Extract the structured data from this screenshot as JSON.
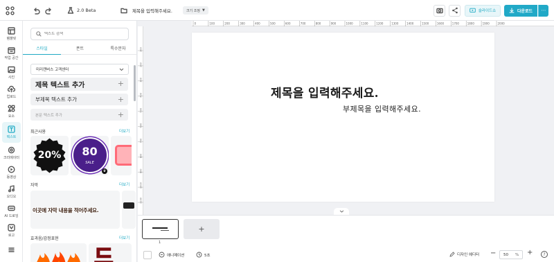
{
  "topbar": {
    "version": "2.0 Beta",
    "doc_title": "제목을 입력해주세요.",
    "size_label": "크기 조정",
    "slideshow_label": "슬라이드쇼",
    "download_label": "다운로드"
  },
  "sidebar": {
    "items": [
      {
        "label": "템플릿",
        "icon": "template-icon"
      },
      {
        "label": "작업 공간",
        "icon": "workspace-icon"
      },
      {
        "label": "사진",
        "icon": "photo-icon"
      },
      {
        "label": "업로드",
        "icon": "upload-icon"
      },
      {
        "label": "요소",
        "icon": "elements-icon"
      },
      {
        "label": "텍스트",
        "icon": "text-icon"
      },
      {
        "label": "크리에이터",
        "icon": "creator-icon"
      },
      {
        "label": "동영상",
        "icon": "video-icon"
      },
      {
        "label": "오디오",
        "icon": "audio-icon"
      },
      {
        "label": "AI 드로잉",
        "icon": "ai-drawing-icon"
      },
      {
        "label": "로고",
        "icon": "logo-icon"
      },
      {
        "label": "",
        "icon": "more-icon"
      }
    ]
  },
  "panel": {
    "search_placeholder": "텍스트 검색",
    "tabs": [
      "스타일",
      "폰트",
      "특수문자"
    ],
    "font_select": "미리캔버스 고객센터",
    "add_title": "제목 텍스트 추가",
    "add_subtitle": "부제목 텍스트 추가",
    "add_body": "본문 텍스트 추가",
    "recent_title": "최근사용",
    "subtitle_section": "자막",
    "effects_title": "효과음/감정표현",
    "more_label": "더보기",
    "recent_badge_text": "20%",
    "recent_sale_num": "80",
    "recent_sale_text": "SALE",
    "subtitle_sample": "이곳에 자막 내용을 적어주세요.",
    "effects_sample": "드"
  },
  "canvas": {
    "title_text": "제목을 입력해주세요.",
    "subtitle_text": "부제목을 입력해주세요.",
    "ruler_ticks": [
      "0",
      "100",
      "200",
      "300",
      "400",
      "500",
      "600",
      "700",
      "800",
      "900",
      "1000",
      "1100",
      "1200",
      "1300",
      "1400",
      "1500",
      "1600",
      "1700",
      "1800",
      "1900",
      "2000"
    ],
    "ruler_v_ticks": [
      "100",
      "200",
      "300",
      "400",
      "500",
      "600",
      "700",
      "800",
      "900",
      "1000",
      "1100"
    ]
  },
  "bottombar": {
    "page_number": "1",
    "animation_label": "애니메이션",
    "duration_label": "5초",
    "design_editor_label": "디자인 에디터",
    "zoom_value": "50",
    "zoom_unit": "%"
  },
  "colors": {
    "accent": "#1faac4",
    "download_bg": "#21a9c7"
  }
}
